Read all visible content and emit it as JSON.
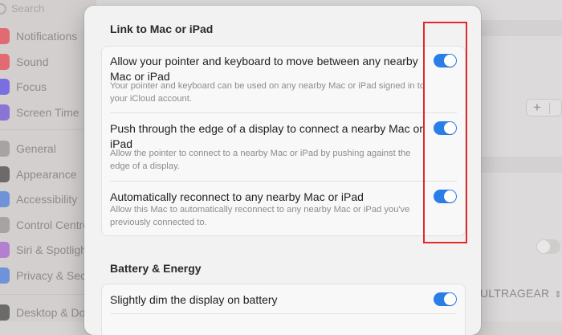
{
  "sidebar": {
    "search_placeholder": "Search",
    "items": [
      {
        "label": "Notifications",
        "icon": "bell-icon",
        "color": "#e26a72"
      },
      {
        "label": "Sound",
        "icon": "speaker-icon",
        "color": "#e26a72"
      },
      {
        "label": "Focus",
        "icon": "moon-icon",
        "color": "#7b6ee0"
      },
      {
        "label": "Screen Time",
        "icon": "hourglass-icon",
        "color": "#8b74d6"
      },
      {
        "label": "General",
        "icon": "gear-icon",
        "color": "#a6a3a3"
      },
      {
        "label": "Appearance",
        "icon": "appearance-icon",
        "color": "#6d6a6a"
      },
      {
        "label": "Accessibility",
        "icon": "accessibility-icon",
        "color": "#6f93d8"
      },
      {
        "label": "Control Centre",
        "icon": "control-centre-icon",
        "color": "#a6a3a3"
      },
      {
        "label": "Siri & Spotlight",
        "icon": "siri-icon",
        "color": "#b57fd0"
      },
      {
        "label": "Privacy & Security",
        "icon": "hand-icon",
        "color": "#6f93d8"
      },
      {
        "label": "Desktop & Dock",
        "icon": "dock-icon",
        "color": "#6d6a6a"
      }
    ]
  },
  "background": {
    "display_name": "ULTRAGEAR",
    "add_remove": "+"
  },
  "sheet": {
    "section1_title": "Link to Mac or iPad",
    "rows": [
      {
        "title": "Allow your pointer and keyboard to move between any nearby Mac or iPad",
        "description": "Your pointer and keyboard can be used on any nearby Mac or iPad signed in to your iCloud account.",
        "enabled": true
      },
      {
        "title": "Push through the edge of a display to connect a nearby Mac or iPad",
        "description": "Allow the pointer to connect to a nearby Mac or iPad by pushing against the edge of a display.",
        "enabled": true
      },
      {
        "title": "Automatically reconnect to any nearby Mac or iPad",
        "description": "Allow this Mac to automatically reconnect to any nearby Mac or iPad you've previously connected to.",
        "enabled": true
      }
    ],
    "section2_title": "Battery & Energy",
    "battery_rows": [
      {
        "title": "Slightly dim the display on battery",
        "enabled": true
      }
    ]
  },
  "colors": {
    "toggle_on": "#2a7ee8",
    "highlight_box": "#e0282d"
  }
}
